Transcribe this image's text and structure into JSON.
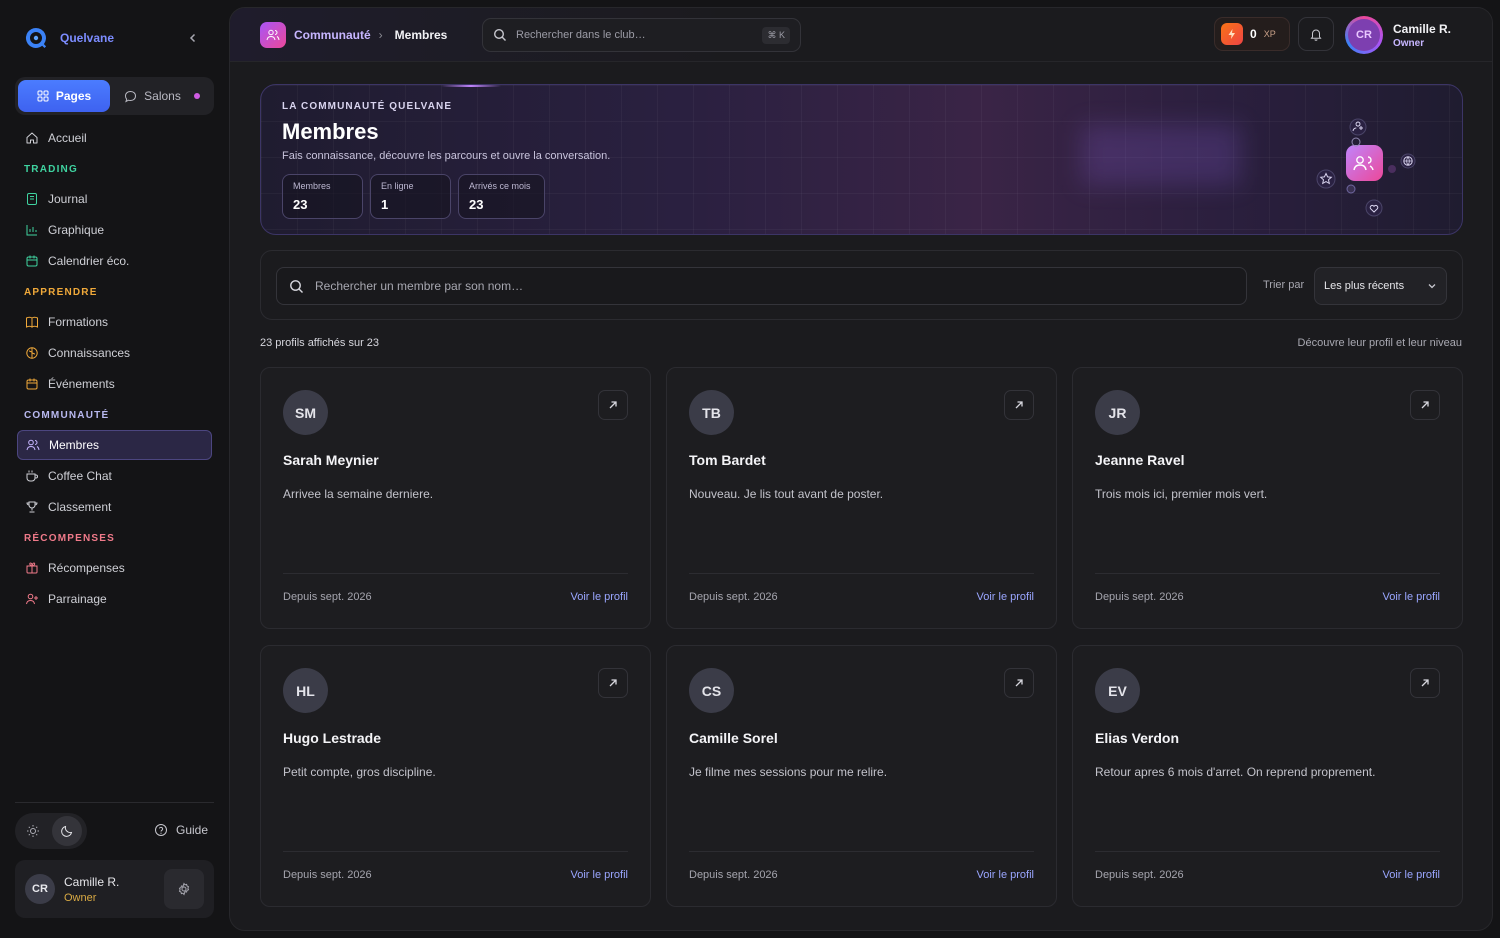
{
  "brand": {
    "name": "Quelvane",
    "accent": "#4b7cff"
  },
  "switcher": {
    "pages": "Pages",
    "salons": "Salons"
  },
  "nav": {
    "home": "Accueil",
    "section_trading": "TRADING",
    "journal": "Journal",
    "chart": "Graphique",
    "calendar": "Calendrier éco.",
    "section_learn": "APPRENDRE",
    "courses": "Formations",
    "knowledge": "Connaissances",
    "events": "Événements",
    "section_community": "COMMUNAUTÉ",
    "members": "Membres",
    "coffee": "Coffee Chat",
    "ranking": "Classement",
    "section_rewards": "RÉCOMPENSES",
    "rewards": "Récompenses",
    "referral": "Parrainage"
  },
  "sidebar_footer": {
    "guide": "Guide",
    "user_initials": "CR",
    "user_name": "Camille R.",
    "user_role": "Owner"
  },
  "topbar": {
    "crumb_parent": "Communauté",
    "crumb_sep": "›",
    "crumb_current": "Membres",
    "search_placeholder": "Rechercher dans le club…",
    "shortcut": "⌘ K",
    "xp_value": "0",
    "xp_unit": "XP",
    "user_initials": "CR",
    "user_name": "Camille R.",
    "user_role": "Owner"
  },
  "hero": {
    "eyebrow": "LA COMMUNAUTÉ QUELVANE",
    "title": "Membres",
    "description": "Fais connaissance, découvre les parcours et ouvre la conversation.",
    "stats": [
      {
        "label": "Membres",
        "value": "23"
      },
      {
        "label": "En ligne",
        "value": "1"
      },
      {
        "label": "Arrivés ce mois",
        "value": "23"
      }
    ]
  },
  "filters": {
    "search_placeholder": "Rechercher un membre par son nom…",
    "sort_label": "Trier par",
    "sort_value": "Les plus récents"
  },
  "listing": {
    "count": "23 profils affichés sur 23",
    "hint": "Découvre leur profil et leur niveau"
  },
  "members": [
    {
      "initials": "SM",
      "name": "Sarah Meynier",
      "bio": "Arrivee la semaine derniere.",
      "since": "Depuis sept. 2026",
      "link": "Voir le profil"
    },
    {
      "initials": "TB",
      "name": "Tom Bardet",
      "bio": "Nouveau. Je lis tout avant de poster.",
      "since": "Depuis sept. 2026",
      "link": "Voir le profil"
    },
    {
      "initials": "JR",
      "name": "Jeanne Ravel",
      "bio": "Trois mois ici, premier mois vert.",
      "since": "Depuis sept. 2026",
      "link": "Voir le profil"
    },
    {
      "initials": "HL",
      "name": "Hugo Lestrade",
      "bio": "Petit compte, gros discipline.",
      "since": "Depuis sept. 2026",
      "link": "Voir le profil"
    },
    {
      "initials": "CS",
      "name": "Camille Sorel",
      "bio": "Je filme mes sessions pour me relire.",
      "since": "Depuis sept. 2026",
      "link": "Voir le profil"
    },
    {
      "initials": "EV",
      "name": "Elias Verdon",
      "bio": "Retour apres 6 mois d'arret. On reprend proprement.",
      "since": "Depuis sept. 2026",
      "link": "Voir le profil"
    }
  ]
}
